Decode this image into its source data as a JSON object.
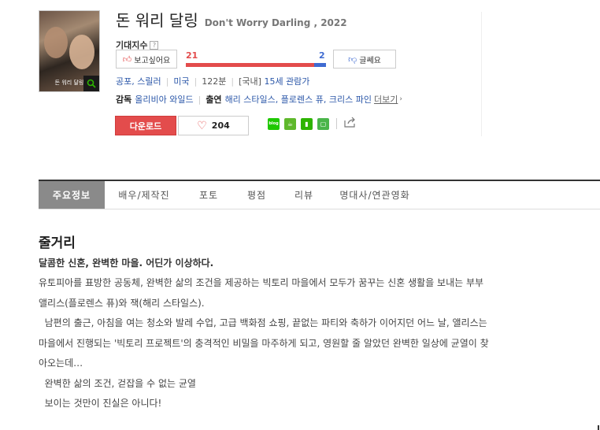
{
  "movie": {
    "title_ko": "돈 워리 달링",
    "title_en": "Don't Worry Darling , 2022",
    "poster_caption": "돈 워리 달링"
  },
  "expectation": {
    "label": "기대지수",
    "like_label": "보고싶어요",
    "dislike_label": "글쎄요",
    "like_count": "21",
    "dislike_count": "2",
    "like_ratio": 0.913
  },
  "meta": {
    "genres": "공포, 스릴러",
    "country": "미국",
    "runtime": "122분",
    "rating_prefix": "[국내]",
    "rating": "15세 관람가"
  },
  "credits": {
    "director_label": "감독",
    "director": "올리비아 와일드",
    "cast_label": "출연",
    "cast": "해리 스타일스, 플로렌스 퓨, 크리스 파인",
    "more_label": "더보기"
  },
  "actions": {
    "download_label": "다운로드",
    "heart_count": "204"
  },
  "share": {
    "icons": [
      "naver-blog-icon",
      "naver-cafe-icon",
      "bookmark-icon",
      "memo-icon",
      "share-out-icon"
    ],
    "blog_text": "blog"
  },
  "tabs": [
    {
      "label": "주요정보",
      "active": true
    },
    {
      "label": "배우/제작진",
      "active": false
    },
    {
      "label": "포토",
      "active": false
    },
    {
      "label": "평점",
      "active": false
    },
    {
      "label": "리뷰",
      "active": false
    },
    {
      "label": "명대사/연관영화",
      "active": false
    }
  ],
  "synopsis": {
    "heading": "줄거리",
    "tagline": "달콤한 신혼, 완벽한 마을. 어딘가 이상하다.",
    "lines": [
      "유토피아를 표방한 공동체, 완벽한 삶의 조건을 제공하는 빅토리 마을에서 모두가 꿈꾸는 신혼 생활을 보내는 부부",
      "앨리스(플로렌스 퓨)와 잭(해리 스타일스).",
      "  남편의 출근, 아침을 여는 청소와 발레 수업, 고급 백화점 쇼핑, 끝없는 파티와 축하가 이어지던 어느 날, 앨리스는",
      "마을에서 진행되는 '빅토리 프로젝트'의 충격적인 비밀을 마주하게 되고, 영원할 줄 알았던 완벽한 일상에 균열이 찾",
      "아오는데…",
      "  완벽한 삶의 조건, 걷잡을 수 없는 균열",
      "  보이는 것만이 진실은 아니다!"
    ]
  },
  "colors": {
    "accent_red": "#e34c4c",
    "accent_blue": "#3f6bd1",
    "tab_active_bg": "#8a8a8a"
  }
}
